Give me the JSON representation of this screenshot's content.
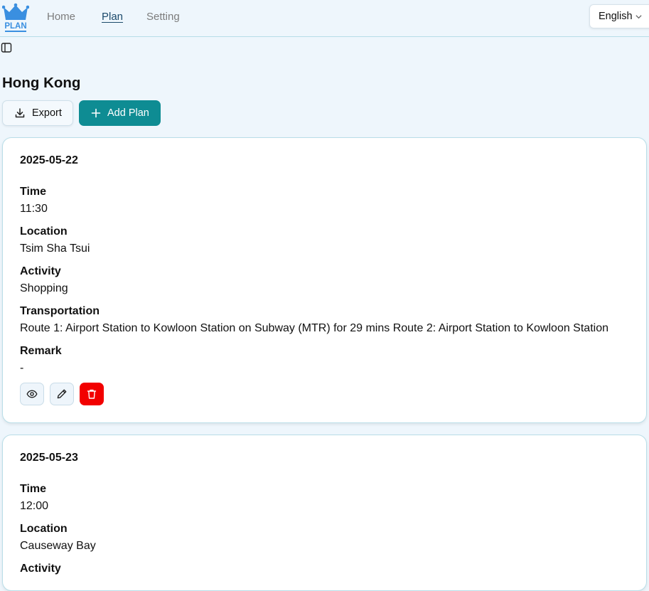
{
  "brand": {
    "logo_text": "PLAN",
    "accent": "#3a8fe0"
  },
  "nav": {
    "home": "Home",
    "plan": "Plan",
    "setting": "Setting"
  },
  "language": {
    "selected": "English"
  },
  "page": {
    "title": "Hong Kong"
  },
  "toolbar": {
    "export_label": "Export",
    "add_label": "Add Plan",
    "add_color": "#0e8c93"
  },
  "labels": {
    "time": "Time",
    "location": "Location",
    "activity": "Activity",
    "transportation": "Transportation",
    "remark": "Remark"
  },
  "plans": [
    {
      "date": "2025-05-22",
      "time": "11:30",
      "location": "Tsim Sha Tsui",
      "activity": "Shopping",
      "transportation": "Route 1: Airport Station to Kowloon Station on Subway (MTR) for 29 mins Route 2: Airport Station to Kowloon Station",
      "remark": "-"
    },
    {
      "date": "2025-05-23",
      "time": "12:00",
      "location": "Causeway Bay"
    }
  ],
  "icons": {
    "view": "eye-icon",
    "edit": "pencil-icon",
    "delete": "trash-icon",
    "export": "download-icon",
    "add": "plus-icon",
    "sidebar": "sidebar-toggle-icon",
    "language": "chevron-down-icon"
  },
  "colors": {
    "delete": "#f20000"
  }
}
